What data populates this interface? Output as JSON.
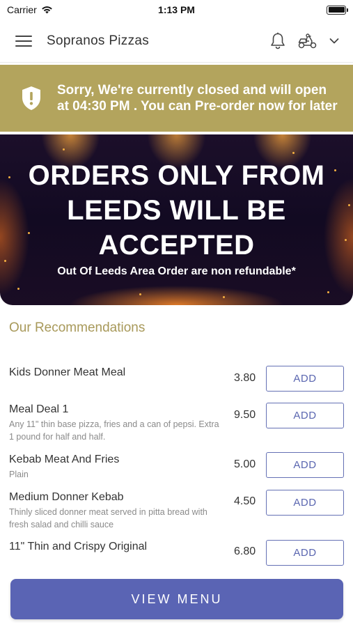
{
  "status_bar": {
    "carrier": "Carrier",
    "time": "1:13 PM"
  },
  "header": {
    "title": "Sopranos Pizzas",
    "icons": [
      "hamburger-menu-icon",
      "bell-icon",
      "scooter-delivery-icon",
      "chevron-down-icon"
    ]
  },
  "closed_banner": {
    "message": "Sorry, We're currently closed and will open at 04:30 PM . You can Pre-order now for later",
    "background": "#b3a45d"
  },
  "hero": {
    "headline": "ORDERS ONLY FROM LEEDS WILL BE ACCEPTED",
    "subtext": "Out Of Leeds Area Order are non refundable*"
  },
  "recommendations": {
    "title": "Our Recommendations",
    "items": [
      {
        "name": "Kids Donner Meat Meal",
        "description": "",
        "price": "3.80",
        "button": "ADD"
      },
      {
        "name": "Meal Deal 1",
        "description": "Any 11\" thin base pizza, fries and a can of pepsi. Extra 1 pound for half and half.",
        "price": "9.50",
        "button": "ADD"
      },
      {
        "name": "Kebab Meat And Fries",
        "description": "Plain",
        "price": "5.00",
        "button": "ADD"
      },
      {
        "name": "Medium Donner Kebab",
        "description": "Thinly sliced donner meat served in pitta bread with fresh salad and chilli sauce",
        "price": "4.50",
        "button": "ADD"
      },
      {
        "name": "11\" Thin and Crispy Original",
        "description": "",
        "price": "6.80",
        "button": "ADD"
      }
    ]
  },
  "view_menu_button": "VIEW MENU",
  "colors": {
    "accent": "#5a64b4",
    "banner": "#b3a45d",
    "recommendations_title": "#a8995a"
  }
}
